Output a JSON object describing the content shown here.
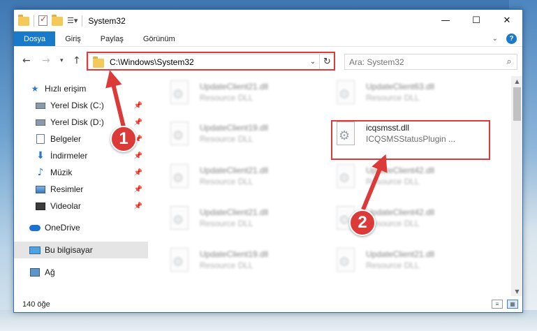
{
  "window": {
    "title": "System32",
    "min_icon": "minimize-icon",
    "max_icon": "maximize-icon",
    "close_icon": "close-icon"
  },
  "ribbon": {
    "tabs": [
      {
        "label": "Dosya"
      },
      {
        "label": "Giriş"
      },
      {
        "label": "Paylaş"
      },
      {
        "label": "Görünüm"
      }
    ]
  },
  "navbar": {
    "address": "C:\\Windows\\System32",
    "search_placeholder": "Ara: System32"
  },
  "sidebar": {
    "items": [
      {
        "label": "Hızlı erişim",
        "icon": "star-icon",
        "pinned": false
      },
      {
        "label": "Yerel Disk (C:)",
        "icon": "drive-icon",
        "pinned": true
      },
      {
        "label": "Yerel Disk (D:)",
        "icon": "drive-icon",
        "pinned": true
      },
      {
        "label": "Belgeler",
        "icon": "documents-icon",
        "pinned": true
      },
      {
        "label": "İndirmeler",
        "icon": "download-icon",
        "pinned": true
      },
      {
        "label": "Müzik",
        "icon": "music-icon",
        "pinned": true
      },
      {
        "label": "Resimler",
        "icon": "pictures-icon",
        "pinned": true
      },
      {
        "label": "Videolar",
        "icon": "videos-icon",
        "pinned": true
      },
      {
        "label": "OneDrive",
        "icon": "onedrive-icon",
        "pinned": false
      },
      {
        "label": "Bu bilgisayar",
        "icon": "computer-icon",
        "pinned": false,
        "selected": true
      },
      {
        "label": "Ağ",
        "icon": "network-icon",
        "pinned": false
      }
    ]
  },
  "files": [
    {
      "name": "UpdateClient21.dll",
      "desc": "Resource DLL",
      "blurred": true
    },
    {
      "name": "UpdateClient63.dll",
      "desc": "Resource DLL",
      "blurred": true
    },
    {
      "name": "UpdateClient19.dll",
      "desc": "Resource DLL",
      "blurred": true
    },
    {
      "name": "icqsmsst.dll",
      "desc": "ICQSMSStatusPlugin ...",
      "blurred": false
    },
    {
      "name": "UpdateClient21.dll",
      "desc": "Resource DLL",
      "blurred": true
    },
    {
      "name": "UpdateClient42.dll",
      "desc": "Resource DLL",
      "blurred": true
    },
    {
      "name": "UpdateClient21.dll",
      "desc": "Resource DLL",
      "blurred": true
    },
    {
      "name": "UpdateClient42.dll",
      "desc": "Resource DLL",
      "blurred": true
    },
    {
      "name": "UpdateClient19.dll",
      "desc": "Resource DLL",
      "blurred": true
    },
    {
      "name": "UpdateClient21.dll",
      "desc": "Resource DLL",
      "blurred": true
    }
  ],
  "status": {
    "count": "140 öğe"
  },
  "annotations": {
    "badge1": "1",
    "badge2": "2",
    "color": "#dc3a38"
  }
}
